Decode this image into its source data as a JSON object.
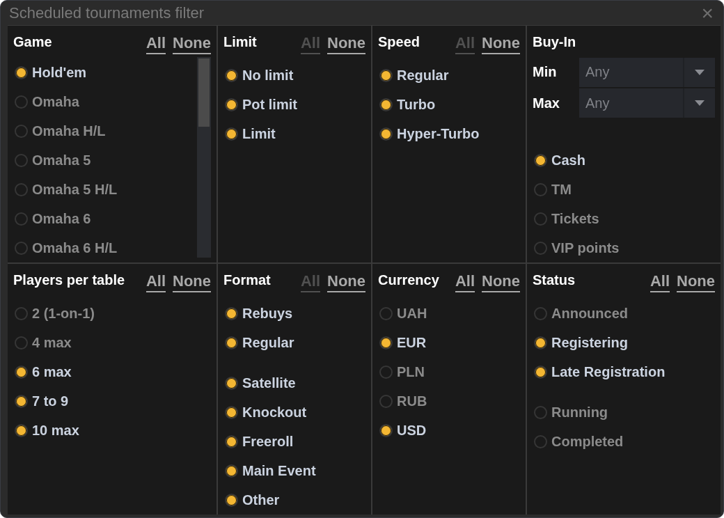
{
  "window": {
    "title": "Scheduled tournaments filter",
    "close": "×"
  },
  "panels": [
    {
      "kind": "options",
      "title": "Game",
      "all": {
        "label": "All",
        "disabled": false
      },
      "none": {
        "label": "None",
        "disabled": false
      },
      "scrollable": true,
      "groups": [
        [
          {
            "label": "Hold'em",
            "checked": true
          },
          {
            "label": "Omaha",
            "checked": false
          },
          {
            "label": "Omaha H/L",
            "checked": false
          },
          {
            "label": "Omaha 5",
            "checked": false
          },
          {
            "label": "Omaha 5 H/L",
            "checked": false
          },
          {
            "label": "Omaha 6",
            "checked": false
          },
          {
            "label": "Omaha 6 H/L",
            "checked": false
          }
        ]
      ]
    },
    {
      "kind": "options",
      "title": "Limit",
      "all": {
        "label": "All",
        "disabled": true
      },
      "none": {
        "label": "None",
        "disabled": false
      },
      "scrollable": false,
      "groups": [
        [
          {
            "label": "No limit",
            "checked": true
          },
          {
            "label": "Pot limit",
            "checked": true
          },
          {
            "label": "Limit",
            "checked": true
          }
        ]
      ]
    },
    {
      "kind": "options",
      "title": "Speed",
      "all": {
        "label": "All",
        "disabled": true
      },
      "none": {
        "label": "None",
        "disabled": false
      },
      "scrollable": false,
      "groups": [
        [
          {
            "label": "Regular",
            "checked": true
          },
          {
            "label": "Turbo",
            "checked": true
          },
          {
            "label": "Hyper-Turbo",
            "checked": true
          }
        ]
      ]
    },
    {
      "kind": "buyin",
      "title": "Buy-In",
      "min": {
        "label": "Min",
        "value": "Any"
      },
      "max": {
        "label": "Max",
        "value": "Any"
      },
      "groups": [
        [
          {
            "label": "Cash",
            "checked": true
          },
          {
            "label": "TM",
            "checked": false
          },
          {
            "label": "Tickets",
            "checked": false
          },
          {
            "label": "VIP points",
            "checked": false
          }
        ]
      ]
    },
    {
      "kind": "options",
      "title": "Players per table",
      "all": {
        "label": "All",
        "disabled": false
      },
      "none": {
        "label": "None",
        "disabled": false
      },
      "scrollable": false,
      "groups": [
        [
          {
            "label": "2 (1-on-1)",
            "checked": false
          },
          {
            "label": "4 max",
            "checked": false
          },
          {
            "label": "6 max",
            "checked": true
          },
          {
            "label": "7 to 9",
            "checked": true
          },
          {
            "label": "10 max",
            "checked": true
          }
        ]
      ]
    },
    {
      "kind": "options",
      "title": "Format",
      "all": {
        "label": "All",
        "disabled": true
      },
      "none": {
        "label": "None",
        "disabled": false
      },
      "scrollable": false,
      "groups": [
        [
          {
            "label": "Rebuys",
            "checked": true
          },
          {
            "label": "Regular",
            "checked": true
          }
        ],
        [
          {
            "label": "Satellite",
            "checked": true
          },
          {
            "label": "Knockout",
            "checked": true
          },
          {
            "label": "Freeroll",
            "checked": true
          },
          {
            "label": "Main Event",
            "checked": true
          },
          {
            "label": "Other",
            "checked": true
          }
        ]
      ]
    },
    {
      "kind": "options",
      "title": "Currency",
      "all": {
        "label": "All",
        "disabled": false
      },
      "none": {
        "label": "None",
        "disabled": false
      },
      "scrollable": false,
      "groups": [
        [
          {
            "label": "UAH",
            "checked": false
          },
          {
            "label": "EUR",
            "checked": true
          },
          {
            "label": "PLN",
            "checked": false
          },
          {
            "label": "RUB",
            "checked": false
          },
          {
            "label": "USD",
            "checked": true
          }
        ]
      ]
    },
    {
      "kind": "options",
      "title": "Status",
      "all": {
        "label": "All",
        "disabled": false
      },
      "none": {
        "label": "None",
        "disabled": false
      },
      "scrollable": false,
      "groups": [
        [
          {
            "label": "Announced",
            "checked": false
          },
          {
            "label": "Registering",
            "checked": true
          },
          {
            "label": "Late Registration",
            "checked": true
          }
        ],
        [
          {
            "label": "Running",
            "checked": false
          },
          {
            "label": "Completed",
            "checked": false
          }
        ]
      ]
    }
  ]
}
